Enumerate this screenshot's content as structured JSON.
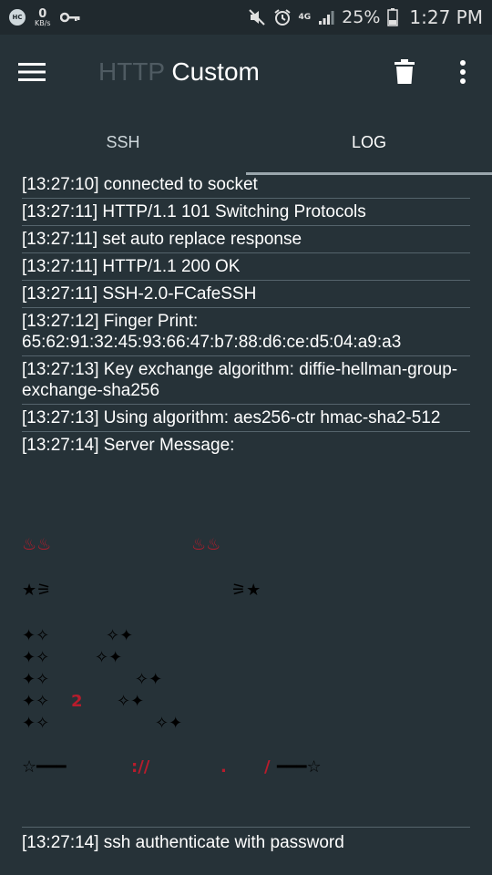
{
  "status_bar": {
    "hc_badge": "HC",
    "net_speed_value": "0",
    "net_speed_unit": "KB/s",
    "network_type": "4G",
    "battery_percent": "25%",
    "time": "1:27 PM",
    "icons": [
      "key-icon",
      "mute-icon",
      "alarm-icon",
      "signal-icon",
      "battery-icon"
    ]
  },
  "app_bar": {
    "title_part1": "HTTP",
    "title_part2": "Custom",
    "icons": [
      "menu-icon",
      "delete-icon",
      "more-vert-icon"
    ]
  },
  "tabs": [
    {
      "label": "SSH",
      "active": false
    },
    {
      "label": "LOG",
      "active": true
    }
  ],
  "log": {
    "entries": [
      "[13:27:10] connected to socket",
      "[13:27:11] HTTP/1.1 101 Switching Protocols",
      "[13:27:11] set auto replace response",
      "[13:27:11] HTTP/1.1 200 OK",
      "[13:27:11] SSH-2.0-FCafeSSH",
      "[13:27:12] Finger Print: 65:62:91:32:45:93:66:47:b7:88:d6:ce:d5:04:a9:a3",
      "[13:27:13] Key exchange algorithm: diffie-hellman-group-exchange-sha256",
      "[13:27:13] Using algorithm: aes256-ctr hmac-sha2-512",
      "[13:27:14] Server Message:"
    ],
    "banner": {
      "row1_left": "♨♨",
      "row1_right": "♨♨",
      "row2_left": "★⚞",
      "row2_right": "⚞★",
      "row3_left": "✦✧",
      "row3_right": "✧✦",
      "row4_left": "✦✧",
      "row4_right": "✧✦",
      "row5_left": "✦✧",
      "row5_right": "✧✦",
      "row6_left": "✦✧",
      "row6_mid": "2",
      "row6_right": "✧✦",
      "row7_left": "✦✧",
      "row7_right": "✧✦",
      "row8_left": "☆━━━",
      "row8_mid1": "://",
      "row8_mid2": ".",
      "row8_mid3": "/",
      "row8_right": "━━━☆"
    },
    "last_entry": "[13:27:14] ssh authenticate with password"
  },
  "colors": {
    "background": "#263238",
    "status_bar": "#20292e",
    "divider": "#55646c",
    "banner_red": "#b71c2c",
    "title_dim": "#4f5b62"
  }
}
